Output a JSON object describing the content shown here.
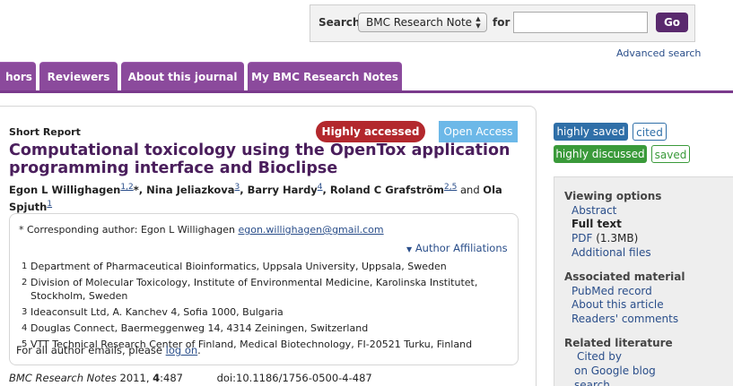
{
  "search": {
    "label": "Search",
    "scope": "BMC Research Note",
    "for_label": "for",
    "input_value": "",
    "go_label": "Go",
    "advanced_label": "Advanced search"
  },
  "nav": {
    "tabs": [
      {
        "label": "hors"
      },
      {
        "label": "Reviewers"
      },
      {
        "label": "About this journal"
      },
      {
        "label": "My BMC Research Notes"
      }
    ]
  },
  "article": {
    "type": "Short Report",
    "badge_accessed": "Highly accessed",
    "badge_open": "Open Access",
    "title": "Computational toxicology using the OpenTox application programming interface and Bioclipse",
    "authors": [
      {
        "name": "Egon L Willighagen",
        "sup": "1,2",
        "star": "*",
        "sep": ", "
      },
      {
        "name": "Nina Jeliazkova",
        "sup": "3",
        "star": "",
        "sep": ", "
      },
      {
        "name": "Barry Hardy",
        "sup": "4",
        "star": "",
        "sep": ", "
      },
      {
        "name": "Roland C Grafström",
        "sup": "2,5",
        "star": "",
        "sep": " and "
      },
      {
        "name": "Ola Spjuth",
        "sup": "1",
        "star": "",
        "sep": ""
      }
    ],
    "corresponding": {
      "label": "* Corresponding author: Egon L Willighagen",
      "email": "egon.willighagen@gmail.com"
    },
    "affil_toggle": "Author Affiliations",
    "affiliations": [
      {
        "num": "1",
        "text": "Department of Pharmaceutical Bioinformatics, Uppsala University, Uppsala, Sweden"
      },
      {
        "num": "2",
        "text": "Division of Molecular Toxicology, Institute of Environmental Medicine, Karolinska Institutet, Stockholm, Sweden"
      },
      {
        "num": "3",
        "text": "Ideaconsult Ltd, A. Kanchev 4, Sofia 1000, Bulgaria"
      },
      {
        "num": "4",
        "text": "Douglas Connect, Baermeggenweg 14, 4314 Zeiningen, Switzerland"
      },
      {
        "num": "5",
        "text": "VTT Technical Research Center of Finland, Medical Biotechnology, FI-20521 Turku, Finland"
      }
    ],
    "email_note": "For all author emails, please",
    "login_link": "log on",
    "email_note_end": ".",
    "citation": {
      "journal": "BMC Research Notes",
      "year": " 2011, ",
      "volume": "4",
      "page": ":487",
      "doi": "doi:10.1186/1756-0500-4-487"
    }
  },
  "badges": {
    "highly_saved": "highly saved",
    "cited": "cited",
    "highly_discussed": "highly discussed",
    "saved": "saved"
  },
  "sidebar": {
    "viewing_options": "Viewing options",
    "abstract": "Abstract",
    "full_text": "Full text",
    "pdf": "PDF",
    "pdf_size": "(1.3MB)",
    "additional_files": "Additional files",
    "associated_material": "Associated material",
    "pubmed": "PubMed record",
    "about_article": "About this article",
    "readers_comments": "Readers' comments",
    "related_literature": "Related literature",
    "cited_by": "Cited by",
    "google_blog": "on Google blog",
    "search": "search"
  },
  "colors": {
    "brand_purple": "#8b4a9c",
    "title_purple": "#4a1e5c",
    "highly_accessed": "#b3282d",
    "open_access": "#6cb8e8",
    "saved_blue": "#2f6fa8",
    "discussed_green": "#3a9a3a"
  }
}
